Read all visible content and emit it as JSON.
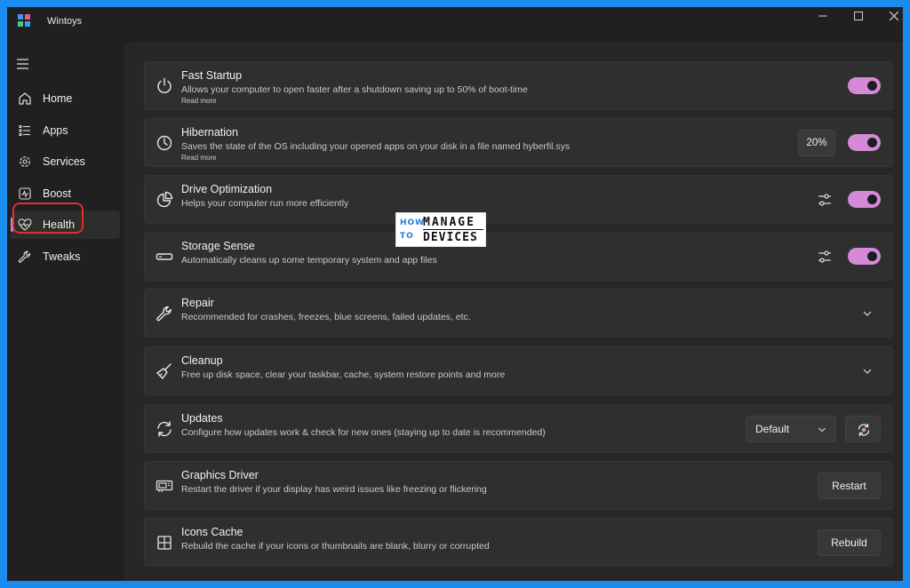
{
  "window": {
    "title": "Wintoys",
    "controls": [
      "minimize",
      "maximize",
      "close"
    ]
  },
  "sidebar": {
    "items": [
      {
        "label": "Home",
        "icon": "home-icon"
      },
      {
        "label": "Apps",
        "icon": "apps-list-icon"
      },
      {
        "label": "Services",
        "icon": "services-gear-icon"
      },
      {
        "label": "Boost",
        "icon": "boost-pulse-icon"
      },
      {
        "label": "Health",
        "icon": "health-heart-icon",
        "active": true
      },
      {
        "label": "Tweaks",
        "icon": "wrench-icon"
      }
    ]
  },
  "cards": [
    {
      "title": "Fast Startup",
      "desc": "Allows your computer to open faster after a shutdown saving up to 50% of boot-time",
      "more": "Read more",
      "icon": "power-icon",
      "toggle": true
    },
    {
      "title": "Hibernation",
      "desc": "Saves the state of the OS including your opened apps on your disk in a file named hyberfil.sys",
      "more": "Read more",
      "icon": "clock-icon",
      "value": "20%",
      "toggle": true
    },
    {
      "title": "Drive Optimization",
      "desc": "Helps your computer run more efficiently",
      "icon": "pie-chart-icon",
      "toggle": true
    },
    {
      "title": "Storage Sense",
      "desc": "Automatically cleans up some temporary system and app files",
      "icon": "drive-icon",
      "toggle": true
    },
    {
      "title": "Repair",
      "desc": "Recommended for crashes, freezes, blue screens, failed updates, etc.",
      "icon": "wrench-icon"
    },
    {
      "title": "Cleanup",
      "desc": "Free up disk space, clear your taskbar, cache, system restore points and more",
      "icon": "broom-icon"
    },
    {
      "title": "Updates",
      "desc": "Configure how updates work & check for new ones (staying up to date is recommended)",
      "icon": "sync-icon",
      "dropdown": "Default"
    },
    {
      "title": "Graphics Driver",
      "desc": "Restart the driver if your display has weird issues like freezing or flickering",
      "icon": "gpu-icon",
      "button": "Restart"
    },
    {
      "title": "Icons Cache",
      "desc": "Rebuild the cache if your icons or thumbnails are blank, blurry or corrupted",
      "icon": "grid-icon",
      "button": "Rebuild"
    }
  ],
  "watermark": {
    "how": "HOW",
    "to": "TO",
    "manage": "MANAGE",
    "devices": "DEVICES"
  },
  "colors": {
    "accent": "#d48ad9",
    "frame": "#1a8cf0",
    "highlight": "#e0302a"
  }
}
